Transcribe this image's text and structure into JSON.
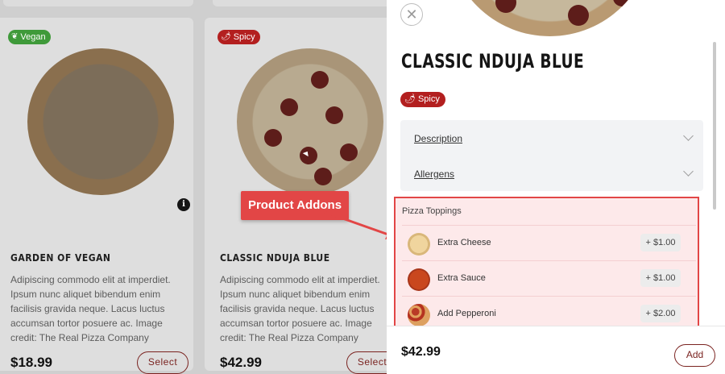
{
  "products": [
    {
      "badge": "Vegan",
      "badge_icon": "leaf-icon",
      "name": "GARDEN OF VEGAN",
      "description": "Adipiscing commodo elit at imperdiet. Ipsum nunc aliquet bibendum enim facilisis gravida neque. Lacus luctus accumsan tortor posuere ac. Image credit: The Real Pizza Company",
      "price": "$18.99",
      "select_label": "Select"
    },
    {
      "badge": "Spicy",
      "badge_icon": "chili-icon",
      "name": "CLASSIC NDUJA BLUE",
      "description": "Adipiscing commodo elit at imperdiet. Ipsum nunc aliquet bibendum enim facilisis gravida neque. Lacus luctus accumsan tortor posuere ac. Image credit: The Real Pizza Company",
      "price": "$42.99",
      "select_label": "Select"
    }
  ],
  "annotation": {
    "label": "Product Addons",
    "color": "#e24646"
  },
  "drawer": {
    "close_icon": "close-icon",
    "title": "CLASSIC NDUJA BLUE",
    "badge": "Spicy",
    "accordion": [
      {
        "label": "Description"
      },
      {
        "label": "Allergens"
      }
    ],
    "toppings": {
      "title": "Pizza Toppings",
      "items": [
        {
          "label": "Extra Cheese",
          "price": "+ $1.00"
        },
        {
          "label": "Extra Sauce",
          "price": "+ $1.00"
        },
        {
          "label": "Add Pepperoni",
          "price": "+ $2.00"
        }
      ]
    },
    "footer": {
      "price": "$42.99",
      "add_label": "Add"
    }
  },
  "colors": {
    "accent": "#7a2320",
    "spicy": "#b31f1f",
    "vegan": "#3f9a3a",
    "highlight": "#e24646"
  }
}
